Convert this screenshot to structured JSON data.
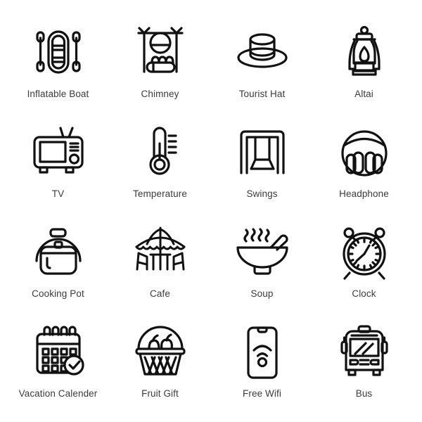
{
  "page": {
    "background_color": "#ffffff",
    "icon_stroke_color": "#111111",
    "label_color": "#3b3b3b",
    "columns": 4,
    "rows": 4
  },
  "icons": [
    {
      "label": "Inflatable Boat",
      "icon_name": "inflatable-boat-icon"
    },
    {
      "label": "Chimney",
      "icon_name": "chimney-icon"
    },
    {
      "label": "Tourist Hat",
      "icon_name": "tourist-hat-icon"
    },
    {
      "label": "Altai",
      "icon_name": "altai-lantern-icon"
    },
    {
      "label": "TV",
      "icon_name": "tv-icon"
    },
    {
      "label": "Temperature",
      "icon_name": "temperature-icon"
    },
    {
      "label": "Swings",
      "icon_name": "swings-icon"
    },
    {
      "label": "Headphone",
      "icon_name": "headphone-icon"
    },
    {
      "label": "Cooking Pot",
      "icon_name": "cooking-pot-icon"
    },
    {
      "label": "Cafe",
      "icon_name": "cafe-icon"
    },
    {
      "label": "Soup",
      "icon_name": "soup-icon"
    },
    {
      "label": "Clock",
      "icon_name": "clock-icon"
    },
    {
      "label": "Vacation Calender",
      "icon_name": "vacation-calendar-icon"
    },
    {
      "label": "Fruit Gift",
      "icon_name": "fruit-gift-icon"
    },
    {
      "label": "Free Wifi",
      "icon_name": "free-wifi-icon"
    },
    {
      "label": "Bus",
      "icon_name": "bus-icon"
    }
  ]
}
